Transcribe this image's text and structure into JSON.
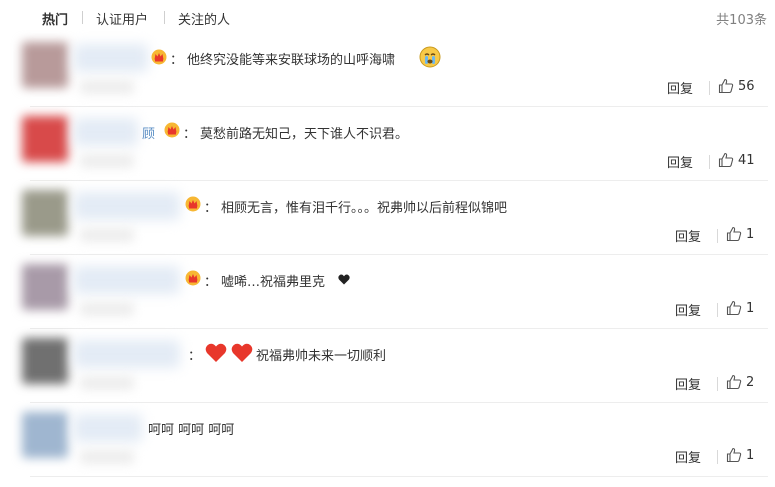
{
  "tabs": [
    {
      "label": "热门"
    },
    {
      "label": "认证用户"
    },
    {
      "label": "关注的人"
    }
  ],
  "total_label": "共103条",
  "reply_label": "回复",
  "comments": [
    {
      "name_tail": "",
      "text": "他终究没能等来安联球场的山呼海啸",
      "likes": "56"
    },
    {
      "name_tail": "顾",
      "text": "莫愁前路无知己，天下谁人不识君。",
      "likes": "41"
    },
    {
      "name_tail": "",
      "text": "相顾无言，惟有泪千行。。。祝弗帅以后前程似锦吧",
      "likes": "1"
    },
    {
      "name_tail": "",
      "text": "嘘唏…祝福弗里克",
      "likes": "1"
    },
    {
      "name_tail": "",
      "text": "祝福弗帅未来一切顺利",
      "likes": "2"
    },
    {
      "name_tail": "",
      "text": "呵呵 呵呵 呵呵",
      "likes": "1"
    }
  ],
  "colors": {
    "username": "#5a8ec4",
    "heart_red": "#e8372b",
    "divider": "#ededed"
  }
}
